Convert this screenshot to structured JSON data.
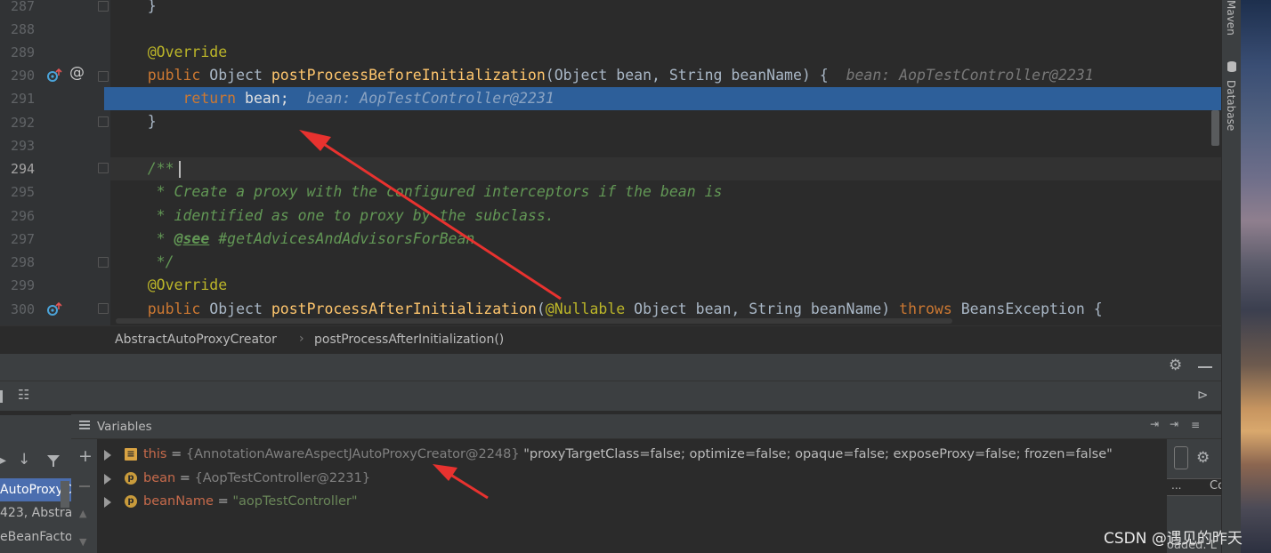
{
  "editor": {
    "line_numbers": [
      "287",
      "288",
      "289",
      "290",
      "291",
      "292",
      "293",
      "294",
      "295",
      "296",
      "297",
      "298",
      "299",
      "300"
    ],
    "lines": {
      "l287": "}",
      "l289_ann": "@Override",
      "l290_kw": "public",
      "l290_type": " Object ",
      "l290_fn": "postProcessBeforeInitialization",
      "l290_params": "(Object bean, String beanName) {",
      "l290_hint": "bean: AopTestController@2231",
      "l291_kw": "return",
      "l291_code": " bean;",
      "l291_hint": "bean: AopTestController@2231",
      "l292": "}",
      "l294": "/**",
      "l295": " * Create a proxy with the configured interceptors if the bean is",
      "l296": " * identified as one to proxy by the subclass.",
      "l297_star": " * ",
      "l297_tag": "@see",
      "l297_rest": " #getAdvicesAndAdvisorsForBean",
      "l298": " */",
      "l299_ann": "@Override",
      "l300_kw": "public",
      "l300_type": " Object ",
      "l300_fn": "postProcessAfterInitialization",
      "l300_p1": "(",
      "l300_ann": "@Nullable",
      "l300_p2": " Object bean, String beanName) ",
      "l300_throws": "throws",
      "l300_exc": " BeansException {"
    }
  },
  "breadcrumb": {
    "class_name": "AbstractAutoProxyCreator",
    "method_name": "postProcessAfterInitialization()"
  },
  "side_tools": {
    "maven": "Maven",
    "database": "Database"
  },
  "frames": {
    "items": [
      "AutoProxyC",
      "423, Abstra",
      "eBeanFactor"
    ]
  },
  "variables": {
    "title": "Variables",
    "rows": [
      {
        "name": "this",
        "eq": " = ",
        "type": "{AnnotationAwareAspectJAutoProxyCreator@2248}",
        "value": " \"proxyTargetClass=false; optimize=false; opaque=false; exposeProxy=false; frozen=false\""
      },
      {
        "name": "bean",
        "eq": " = ",
        "type": "{AopTestController@2231}",
        "value": ""
      },
      {
        "name": "beanName",
        "eq": " = ",
        "type": "",
        "value": "\"aopTestController\""
      }
    ],
    "right_cols": [
      "...",
      "Co"
    ],
    "right_footer": "oaded. L"
  },
  "watermark": "CSDN @遇见的昨天",
  "colors": {
    "selection": "#2d5f9a",
    "arrow": "#e8322f"
  }
}
